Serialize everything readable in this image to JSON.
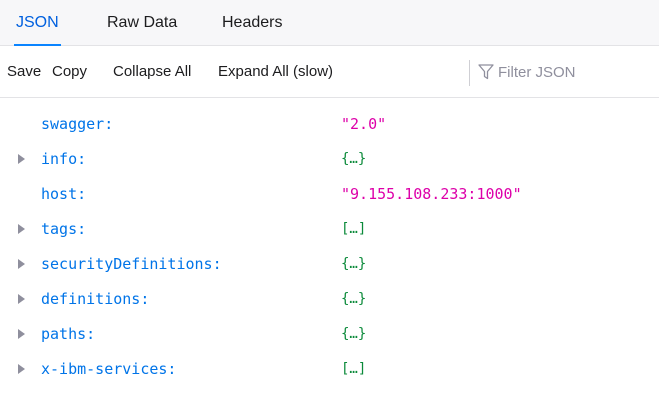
{
  "tabs": [
    {
      "label": "JSON",
      "active": true
    },
    {
      "label": "Raw Data",
      "active": false
    },
    {
      "label": "Headers",
      "active": false
    }
  ],
  "toolbar": {
    "save": "Save",
    "copy": "Copy",
    "collapse_all": "Collapse All",
    "expand_all": "Expand All (slow)",
    "filter_placeholder": "Filter JSON",
    "filter_icon": "funnel-icon"
  },
  "tree": {
    "rows": [
      {
        "key": "swagger:",
        "value": "\"2.0\"",
        "kind": "string",
        "expandable": false
      },
      {
        "key": "info:",
        "value": "{…}",
        "kind": "object",
        "expandable": true
      },
      {
        "key": "host:",
        "value": "\"9.155.108.233:1000\"",
        "kind": "string",
        "expandable": false
      },
      {
        "key": "tags:",
        "value": "[…]",
        "kind": "array",
        "expandable": true
      },
      {
        "key": "securityDefinitions:",
        "value": "{…}",
        "kind": "object",
        "expandable": true
      },
      {
        "key": "definitions:",
        "value": "{…}",
        "kind": "object",
        "expandable": true
      },
      {
        "key": "paths:",
        "value": "{…}",
        "kind": "object",
        "expandable": true
      },
      {
        "key": "x-ibm-services:",
        "value": "[…]",
        "kind": "array",
        "expandable": true
      }
    ]
  },
  "colors": {
    "key": "#0074e8",
    "string": "#dd00a9",
    "summary": "#0b8a3a",
    "active_tab": "#0060df",
    "tab_bar": "#f7f7f9"
  }
}
